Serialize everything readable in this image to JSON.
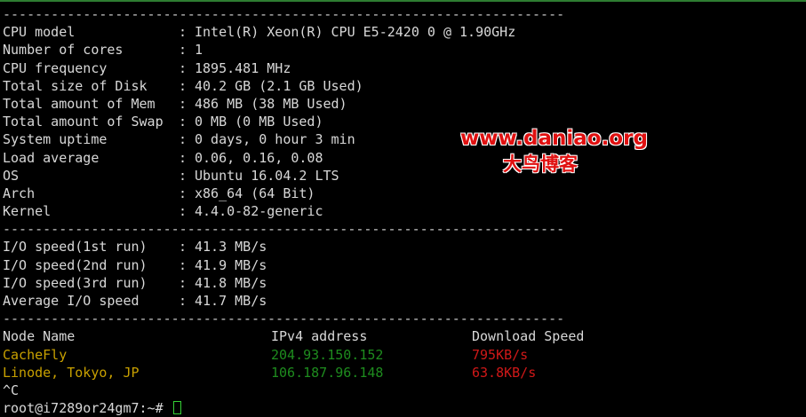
{
  "separator": "----------------------------------------------------------------------",
  "system_info": [
    {
      "label": "CPU model",
      "value": "Intel(R) Xeon(R) CPU E5-2420 0 @ 1.90GHz"
    },
    {
      "label": "Number of cores",
      "value": "1"
    },
    {
      "label": "CPU frequency",
      "value": "1895.481 MHz"
    },
    {
      "label": "Total size of Disk",
      "value": "40.2 GB (2.1 GB Used)"
    },
    {
      "label": "Total amount of Mem",
      "value": "486 MB (38 MB Used)"
    },
    {
      "label": "Total amount of Swap",
      "value": "0 MB (0 MB Used)"
    },
    {
      "label": "System uptime",
      "value": "0 days, 0 hour 3 min"
    },
    {
      "label": "Load average",
      "value": "0.06, 0.16, 0.08"
    },
    {
      "label": "OS",
      "value": "Ubuntu 16.04.2 LTS"
    },
    {
      "label": "Arch",
      "value": "x86_64 (64 Bit)"
    },
    {
      "label": "Kernel",
      "value": "4.4.0-82-generic"
    }
  ],
  "colon": ":",
  "io_speed": [
    {
      "label": "I/O speed(1st run)",
      "value": "41.3 MB/s"
    },
    {
      "label": "I/O speed(2nd run)",
      "value": "41.9 MB/s"
    },
    {
      "label": "I/O speed(3rd run)",
      "value": "41.8 MB/s"
    },
    {
      "label": "Average I/O speed",
      "value": "41.7 MB/s"
    }
  ],
  "network_table": {
    "headers": {
      "name": "Node Name",
      "ip": "IPv4 address",
      "speed": "Download Speed"
    },
    "rows": [
      {
        "name": "CacheFly",
        "ip": "204.93.150.152",
        "speed": "795KB/s"
      },
      {
        "name": "Linode, Tokyo, JP",
        "ip": "106.187.96.148",
        "speed": "63.8KB/s"
      }
    ]
  },
  "interrupt_text": "^C",
  "prompt_text": "root@i7289or24gm7:~#",
  "watermark": {
    "url": "www.daniao.org",
    "name": "大鸟博客"
  },
  "colors": {
    "background": "#000000",
    "text": "#d8d8d8",
    "node_name": "#c8a000",
    "node_ip": "#1e8c1e",
    "node_speed": "#d01818",
    "watermark": "#e01010"
  }
}
